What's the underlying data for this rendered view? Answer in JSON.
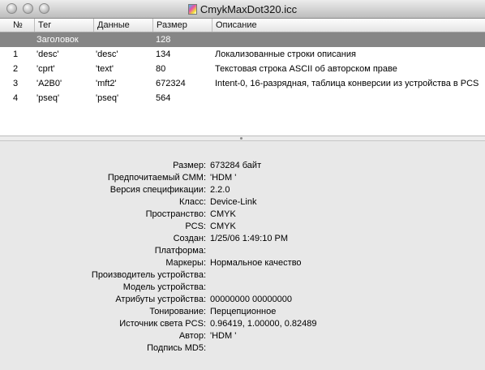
{
  "window": {
    "title": "CmykMaxDot320.icc"
  },
  "table": {
    "columns": [
      "№",
      "Тег",
      "Данные",
      "Размер",
      "Описание"
    ],
    "header_row": {
      "num": "",
      "tag": "Заголовок",
      "data": "",
      "size": "128",
      "desc": ""
    },
    "rows": [
      {
        "num": "1",
        "tag": "'desc'",
        "data": "'desc'",
        "size": "134",
        "desc": "Локализованные строки описания"
      },
      {
        "num": "2",
        "tag": "'cprt'",
        "data": "'text'",
        "size": "80",
        "desc": "Текстовая строка ASCII об авторском праве"
      },
      {
        "num": "3",
        "tag": "'A2B0'",
        "data": "'mft2'",
        "size": "672324",
        "desc": "Intent-0, 16-разрядная, таблица конверсии из устройства в PCS"
      },
      {
        "num": "4",
        "tag": "'pseq'",
        "data": "'pseq'",
        "size": "564",
        "desc": ""
      }
    ]
  },
  "info": [
    {
      "label": "Размер:",
      "value": "673284 байт"
    },
    {
      "label": "Предпочитаемый CMM:",
      "value": "'HDM '"
    },
    {
      "label": "Версия спецификации:",
      "value": "2.2.0"
    },
    {
      "label": "Класс:",
      "value": "Device-Link"
    },
    {
      "label": "Пространство:",
      "value": "CMYK"
    },
    {
      "label": "PCS:",
      "value": "CMYK"
    },
    {
      "label": "Создан:",
      "value": "1/25/06 1:49:10 PM"
    },
    {
      "label": "Платформа:",
      "value": ""
    },
    {
      "label": "Маркеры:",
      "value": "Нормальное качество"
    },
    {
      "label": "Производитель устройства:",
      "value": ""
    },
    {
      "label": "Модель устройства:",
      "value": ""
    },
    {
      "label": "Атрибуты устройства:",
      "value": "00000000 00000000"
    },
    {
      "label": "Тонирование:",
      "value": "Перцепционное"
    },
    {
      "label": "Источник света PCS:",
      "value": "0.96419, 1.00000, 0.82489"
    },
    {
      "label": "Автор:",
      "value": "'HDM '"
    },
    {
      "label": "Подпись MD5:",
      "value": ""
    }
  ]
}
